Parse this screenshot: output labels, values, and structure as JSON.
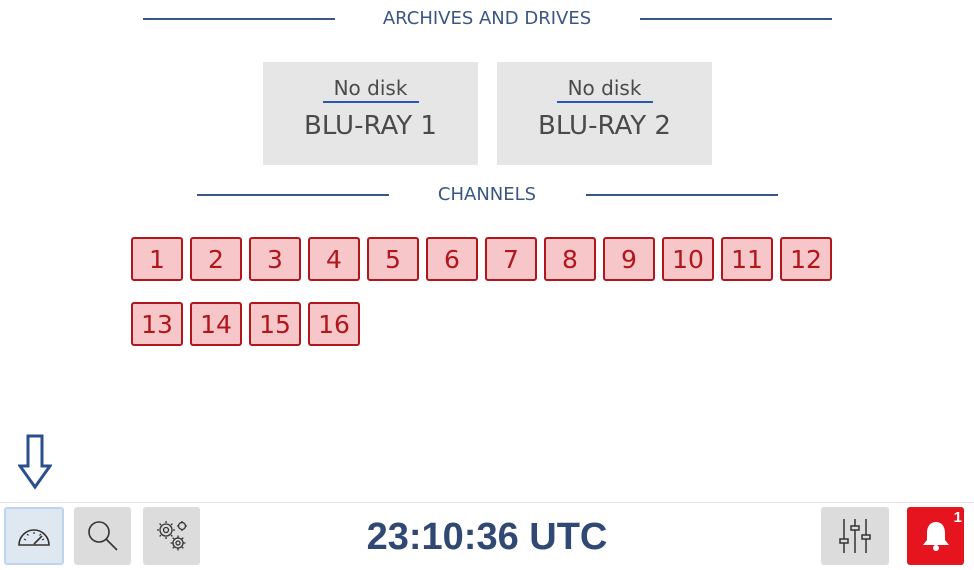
{
  "archives": {
    "header": "ARCHIVES AND DRIVES",
    "drives": [
      {
        "status": "No disk",
        "name": "BLU-RAY 1"
      },
      {
        "status": "No disk",
        "name": "BLU-RAY 2"
      }
    ]
  },
  "channels": {
    "header": "CHANNELS",
    "items": [
      "1",
      "2",
      "3",
      "4",
      "5",
      "6",
      "7",
      "8",
      "9",
      "10",
      "11",
      "12",
      "13",
      "14",
      "15",
      "16"
    ]
  },
  "toolbar": {
    "clock": "23:10:36 UTC",
    "alarm_count": "1",
    "icons": [
      "speedometer-icon",
      "search-icon",
      "gears-icon",
      "mixer-sliders-icon",
      "bell-icon"
    ]
  },
  "colors": {
    "accent": "#3b5684",
    "channel_border": "#b0171d",
    "channel_fill": "#f7c6c8",
    "alarm": "#e5141e"
  }
}
